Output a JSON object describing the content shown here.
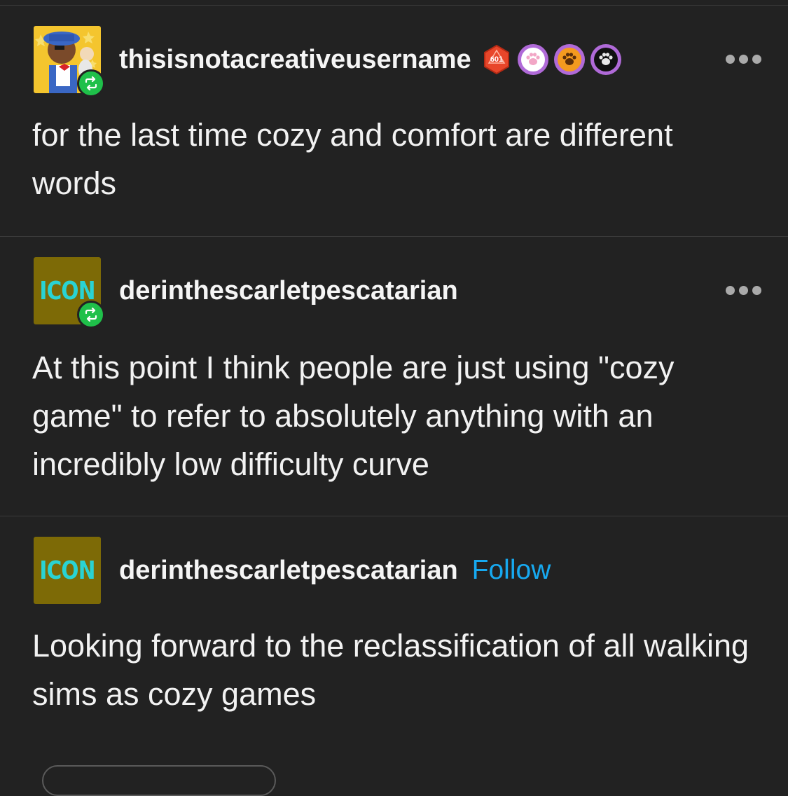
{
  "posts": [
    {
      "username": "thisisnotacreativeusername",
      "avatar_type": "cartoon-character",
      "reblog_icon": "reblog-icon",
      "badges": [
        {
          "name": "d20-badge",
          "label": "601",
          "color": "#e8462a"
        },
        {
          "name": "paw-badge-white",
          "color": "#ffffff"
        },
        {
          "name": "paw-badge-orange",
          "color": "#f39a1f"
        },
        {
          "name": "paw-badge-black",
          "color": "#111111"
        }
      ],
      "text": "for the last time cozy and comfort are different words"
    },
    {
      "username": "derinthescarletpescatarian",
      "avatar_text": "ICON",
      "reblog_icon": "reblog-icon",
      "text": "At this point I think people are just using \"cozy game\" to refer to absolutely anything with an incredibly low difficulty curve"
    },
    {
      "username": "derinthescarletpescatarian",
      "avatar_text": "ICON",
      "follow_label": "Follow",
      "text": "Looking forward to the reclassification of all walking sims as cozy games"
    }
  ],
  "colors": {
    "background": "#222222",
    "reblog_green": "#1fc04a",
    "follow_blue": "#17a9f0",
    "icon_avatar_bg": "#7d6a06",
    "icon_avatar_text": "#29d3d3"
  }
}
